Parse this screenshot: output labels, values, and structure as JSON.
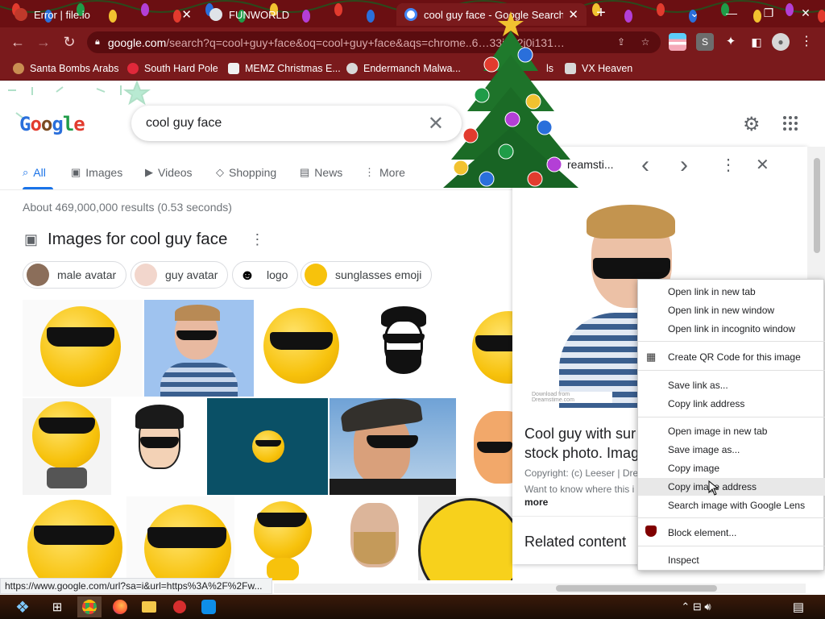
{
  "browser": {
    "tabs": [
      {
        "label": "Error | file.io",
        "icon_color": "#c0392b",
        "close": "✕"
      },
      {
        "label": "FUNWORLD",
        "icon_color": "#dfe3e8",
        "close": "✕"
      },
      {
        "label": "cool guy face - Google Search",
        "icon_color": "#ffffff",
        "close": "✕"
      }
    ],
    "new_tab": "+",
    "window_controls": {
      "dropdown": "⌄",
      "minimize": "—",
      "restore": "❐",
      "close": "✕"
    },
    "address": {
      "host": "google.com",
      "path": "/search?q=cool+guy+face&oq=cool+guy+face&aqs=chrome..6…33i512j0i131…"
    },
    "bookmarks": [
      {
        "label": "Santa Bombs Arabs",
        "color": "#c98e52"
      },
      {
        "label": "South Hard Pole",
        "color": "#e0283a"
      },
      {
        "label": "MEMZ Christmas E...",
        "color": "#f0f0f0"
      },
      {
        "label": "Endermanch Malwa...",
        "color": "#d8d8d8"
      },
      {
        "label": "ls",
        "color": "#e0283a"
      },
      {
        "label": "VX Heaven",
        "color": "#d8d8d8"
      }
    ],
    "status_url": "https://www.google.com/url?sa=i&url=https%3A%2F%2Fw..."
  },
  "google": {
    "logo_letters": [
      "G",
      "o",
      "o",
      "g",
      "l",
      "e"
    ],
    "logo_colors": [
      "#2a6fdb",
      "#e23b2e",
      "#7a4a20",
      "#2a6fdb",
      "#1f9c48",
      "#e23b2e"
    ],
    "search_value": "cool guy face",
    "clear_glyph": "✕",
    "settings_glyph": "⚙",
    "apps_glyph": "⋮⋮⋮",
    "nav_tabs": [
      {
        "icon": "🔍︎",
        "label": "All"
      },
      {
        "icon": "▣",
        "label": "Images"
      },
      {
        "icon": "▶",
        "label": "Videos"
      },
      {
        "icon": "◇",
        "label": "Shopping"
      },
      {
        "icon": "▤",
        "label": "News"
      },
      {
        "icon": "⋮",
        "label": "More"
      }
    ],
    "result_stats": "About 469,000,000 results (0.53 seconds)",
    "images_heading": "Images for cool guy face",
    "chips": [
      "male avatar",
      "guy avatar",
      "logo",
      "sunglasses emoji"
    ]
  },
  "panel": {
    "source": "reamsti...",
    "prev": "‹",
    "next": "›",
    "more": "⋮",
    "close": "✕",
    "watermark": "Download from Dreamstime.com",
    "title_line1": "Cool guy with sur",
    "title_line2": "stock photo. Imag",
    "copyright": "Copyright: (c) Leeser | Dre",
    "desc": "Want to know where this i",
    "more_link": "more",
    "related": "Related content"
  },
  "context_menu": {
    "items": [
      {
        "label": "Open link in new tab"
      },
      {
        "label": "Open link in new window"
      },
      {
        "label": "Open link in incognito window"
      },
      {
        "label": "Create QR Code for this image"
      },
      {
        "label": "Save link as..."
      },
      {
        "label": "Copy link address"
      },
      {
        "label": "Open image in new tab"
      },
      {
        "label": "Save image as..."
      },
      {
        "label": "Copy image"
      },
      {
        "label": "Copy image address"
      },
      {
        "label": "Search image with Google Lens"
      },
      {
        "label": "Block element..."
      },
      {
        "label": "Inspect"
      }
    ]
  },
  "taskbar": {
    "start": "❖",
    "task_view": "⊞",
    "apps": [
      "chrome",
      "firefox",
      "explorer",
      "virus-app",
      "teamviewer"
    ],
    "tray": "⌃  ⊟  🔊︎",
    "notify": "▤"
  }
}
